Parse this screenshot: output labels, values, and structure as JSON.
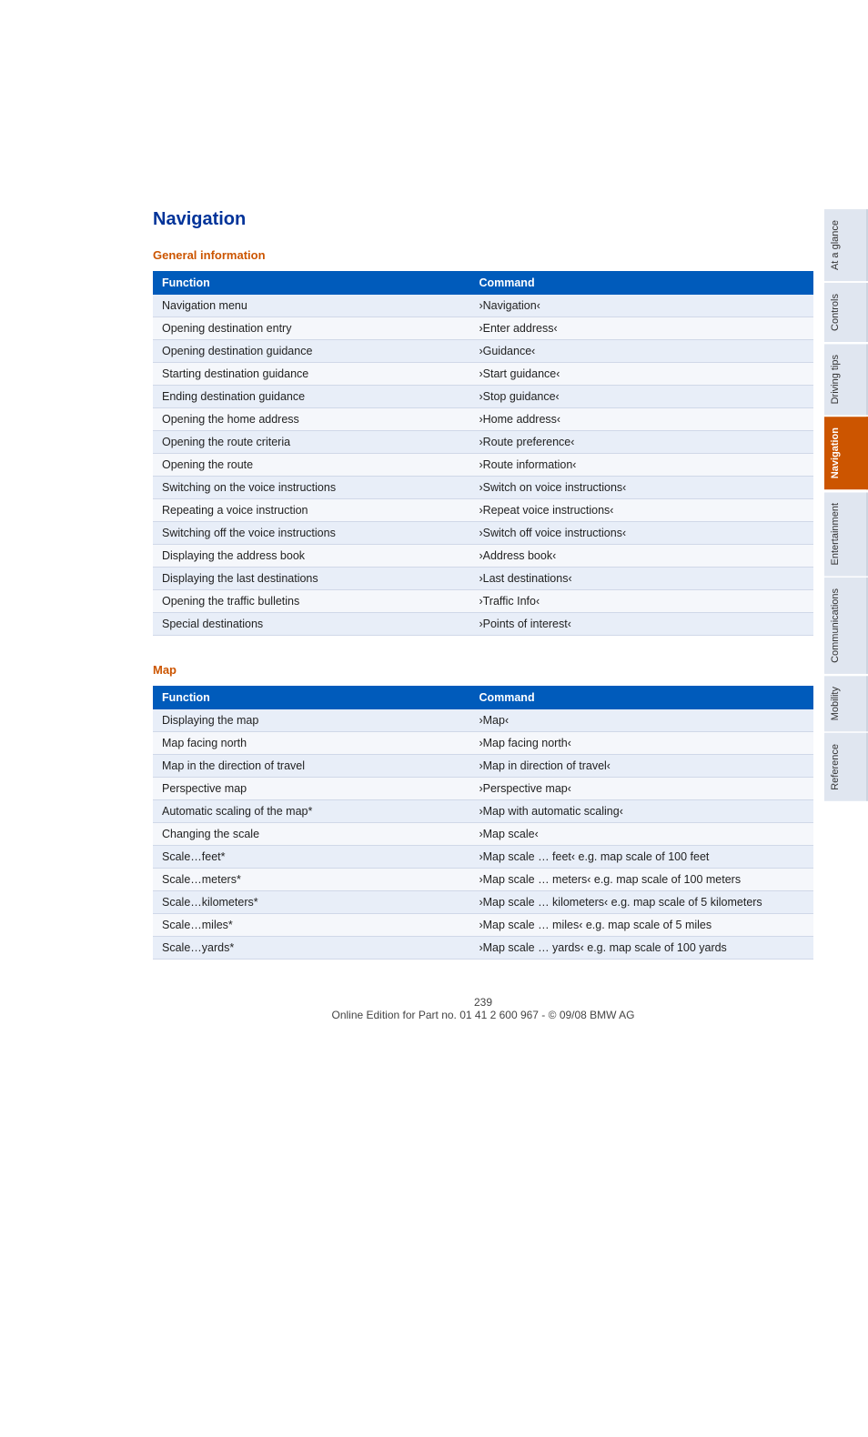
{
  "page": {
    "title": "Navigation",
    "footer_text": "239",
    "footer_sub": "Online Edition for Part no. 01 41 2 600 967  -  © 09/08 BMW AG"
  },
  "sections": [
    {
      "id": "general-information",
      "title": "General information",
      "col1_header": "Function",
      "col2_header": "Command",
      "rows": [
        {
          "function": "Navigation menu",
          "command": "›Navigation‹"
        },
        {
          "function": "Opening destination entry",
          "command": "›Enter address‹"
        },
        {
          "function": "Opening destination guidance",
          "command": "›Guidance‹"
        },
        {
          "function": "Starting destination guidance",
          "command": "›Start guidance‹"
        },
        {
          "function": "Ending destination guidance",
          "command": "›Stop guidance‹"
        },
        {
          "function": "Opening the home address",
          "command": "›Home address‹"
        },
        {
          "function": "Opening the route criteria",
          "command": "›Route preference‹"
        },
        {
          "function": "Opening the route",
          "command": "›Route information‹"
        },
        {
          "function": "Switching on the voice instructions",
          "command": "›Switch on voice instructions‹"
        },
        {
          "function": "Repeating a voice instruction",
          "command": "›Repeat voice instructions‹"
        },
        {
          "function": "Switching off the voice instructions",
          "command": "›Switch off voice instructions‹"
        },
        {
          "function": "Displaying the address book",
          "command": "›Address book‹"
        },
        {
          "function": "Displaying the last destinations",
          "command": "›Last destinations‹"
        },
        {
          "function": "Opening the traffic bulletins",
          "command": "›Traffic Info‹"
        },
        {
          "function": "Special destinations",
          "command": "›Points of interest‹"
        }
      ]
    },
    {
      "id": "map",
      "title": "Map",
      "col1_header": "Function",
      "col2_header": "Command",
      "rows": [
        {
          "function": "Displaying the map",
          "command": "›Map‹",
          "asterisk": false
        },
        {
          "function": "Map facing north",
          "command": "›Map facing north‹",
          "asterisk": false
        },
        {
          "function": "Map in the direction of travel",
          "command": "›Map in direction of travel‹",
          "asterisk": false
        },
        {
          "function": "Perspective map",
          "command": "›Perspective map‹",
          "asterisk": false
        },
        {
          "function": "Automatic scaling of the map*",
          "command": "›Map with automatic scaling‹",
          "asterisk": true
        },
        {
          "function": "Changing the scale",
          "command": "›Map scale‹",
          "asterisk": false
        },
        {
          "function": "Scale…feet*",
          "command": "›Map scale …  feet‹ e.g. map scale of 100 feet",
          "asterisk": true
        },
        {
          "function": "Scale…meters*",
          "command": "›Map scale …  meters‹ e.g. map scale of 100 meters",
          "asterisk": true
        },
        {
          "function": "Scale…kilometers*",
          "command": "›Map scale …  kilometers‹ e.g. map scale of 5 kilometers",
          "asterisk": true
        },
        {
          "function": "Scale…miles*",
          "command": "›Map scale …  miles‹ e.g. map scale of 5 miles",
          "asterisk": true
        },
        {
          "function": "Scale…yards*",
          "command": "›Map scale …  yards‹ e.g. map scale of 100 yards",
          "asterisk": true
        }
      ]
    }
  ],
  "sidebar_tabs": [
    {
      "label": "At a glance",
      "active": false
    },
    {
      "label": "Controls",
      "active": false
    },
    {
      "label": "Driving tips",
      "active": false
    },
    {
      "label": "Navigation",
      "active": true,
      "highlight": true
    },
    {
      "label": "Entertainment",
      "active": false
    },
    {
      "label": "Communications",
      "active": false
    },
    {
      "label": "Mobility",
      "active": false
    },
    {
      "label": "Reference",
      "active": false
    }
  ]
}
